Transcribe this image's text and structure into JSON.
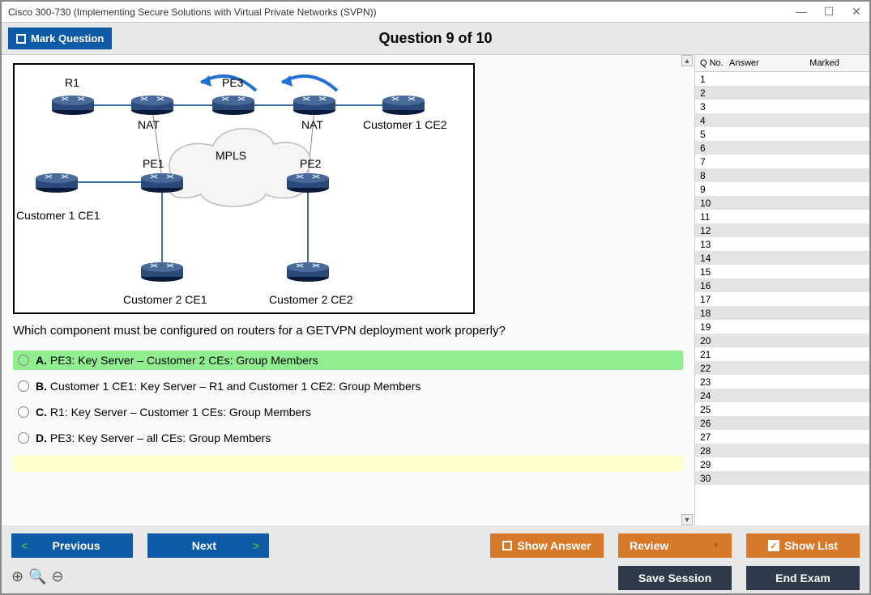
{
  "window_title": "Cisco 300-730 (Implementing Secure Solutions with Virtual Private Networks (SVPN))",
  "header": {
    "mark_button": "Mark Question",
    "question_title": "Question 9 of 10"
  },
  "diagram": {
    "labels": {
      "r1": "R1",
      "pe3": "PE3",
      "nat1": "NAT",
      "nat2": "NAT",
      "cust1ce2": "Customer 1 CE2",
      "pe1": "PE1",
      "pe2": "PE2",
      "mpls": "MPLS",
      "cust1ce1": "Customer 1 CE1",
      "cust2ce1": "Customer 2 CE1",
      "cust2ce2": "Customer 2 CE2"
    }
  },
  "question_text": "Which component must be configured on routers for a GETVPN deployment work properly?",
  "options": [
    {
      "letter": "A.",
      "text": "PE3: Key Server – Customer 2 CEs: Group Members",
      "correct": true
    },
    {
      "letter": "B.",
      "text": "Customer 1 CE1: Key Server – R1 and Customer 1 CE2: Group Members",
      "correct": false
    },
    {
      "letter": "C.",
      "text": "R1: Key Server – Customer 1 CEs: Group Members",
      "correct": false
    },
    {
      "letter": "D.",
      "text": "PE3: Key Server – all CEs: Group Members",
      "correct": false
    }
  ],
  "side": {
    "h_qno": "Q No.",
    "h_answer": "Answer",
    "h_marked": "Marked",
    "count": 30
  },
  "footer": {
    "previous": "Previous",
    "next": "Next",
    "show_answer": "Show Answer",
    "review": "Review",
    "show_list": "Show List",
    "save_session": "Save Session",
    "end_exam": "End Exam"
  }
}
